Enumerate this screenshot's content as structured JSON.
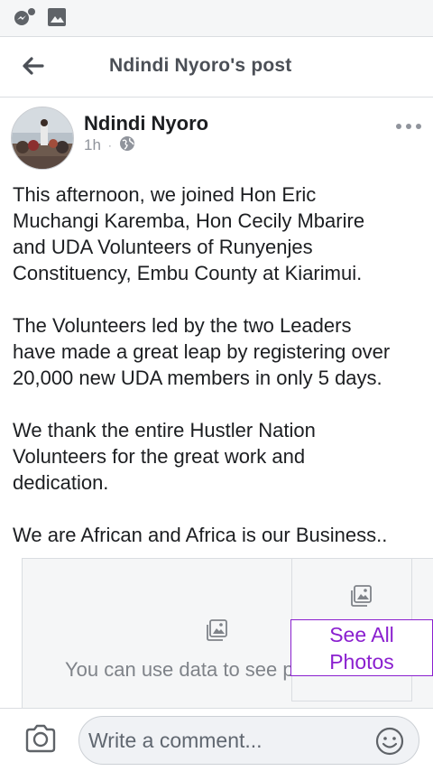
{
  "status_bar": {
    "icons": [
      "messenger-notification-icon",
      "gallery-icon"
    ]
  },
  "header": {
    "title": "Ndindi Nyoro's post",
    "back_icon": "back-arrow-icon"
  },
  "post": {
    "author": "Ndindi Nyoro",
    "time": "1h",
    "separator": "·",
    "audience_icon": "globe-icon",
    "more_icon": "more-options-icon",
    "paragraphs": [
      "This afternoon, we joined Hon Eric\nMuchangi Karemba, Hon Cecily Mbarire\nand UDA Volunteers of Runyenjes\nConstituency, Embu County at Kiarimui.",
      "The Volunteers led by the two Leaders\nhave made a great leap by registering over\n20,000 new UDA members in only 5 days.",
      "We thank the entire Hustler Nation\nVolunteers for the great work and\ndedication.",
      "We are African and Africa is our Business.."
    ]
  },
  "photos": {
    "message": "You can use data to see photos",
    "see_all_line1": "See All",
    "see_all_line2": "Photos",
    "accent": "#8a1fcf"
  },
  "comment_bar": {
    "placeholder": "Write a comment...",
    "camera_icon": "camera-icon",
    "emoji_icon": "emoji-icon"
  }
}
